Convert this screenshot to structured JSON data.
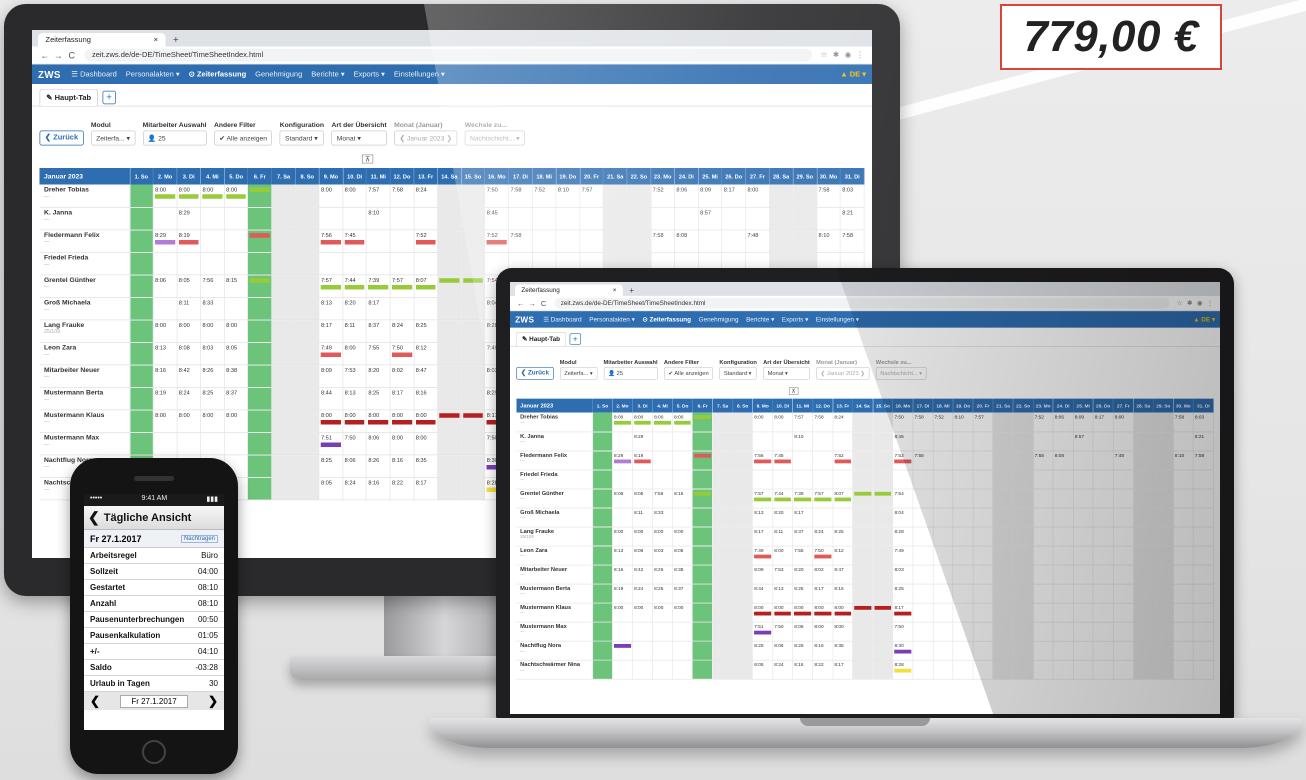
{
  "price": "779,00 €",
  "browser": {
    "tab_title": "Zeiterfassung",
    "tab_close": "×",
    "tab_add": "+",
    "back": "←",
    "forward": "→",
    "reload": "C",
    "url": "zeit.zws.de/de-DE/TimeSheet/TimeSheetIndex.html",
    "icons": [
      "star-icon",
      "extensions-icon",
      "profile-icon",
      "menu-icon"
    ]
  },
  "app": {
    "logo": "ZWS",
    "nav": [
      "☰ Dashboard",
      "Personalakten ▾",
      "⊙ Zeiterfassung",
      "Genehmigung",
      "Berichte ▾",
      "Exports ▾",
      "Einstellungen ▾"
    ],
    "nav_right": "▲ DE ▾",
    "view_tab": "✎ Haupt-Tab",
    "add_tab": "+",
    "filters": {
      "back_button": "❮ Zurück",
      "modul_label": "Modul",
      "modul_value": "Zeiterfa...   ▾",
      "mitarbeiter_label": "Mitarbeiter Auswahl",
      "mitarbeiter_value": "👤 25",
      "andere_filter_label": "Andere Filter",
      "andere_filter_value": "✔ Alle anzeigen",
      "konfiguration_label": "Konfiguration",
      "konfiguration_value": "Standard   ▾",
      "uebersicht_label": "Art der Übersicht",
      "uebersicht_value": "Monat                ▾",
      "monat_label": "Monat (Januar)",
      "monat_value": "❮   Januar 2023   ❯",
      "wechsle_label": "Wechsle zu...",
      "wechsle_value": "Nachtschicht...   ▾",
      "collapse": "⊼"
    },
    "grid": {
      "month_header": "Januar 2023",
      "days": [
        "1. So",
        "2. Mo",
        "3. Di",
        "4. Mi",
        "5. Do",
        "6. Fr",
        "7. Sa",
        "8. So",
        "9. Mo",
        "10. Di",
        "11. Mi",
        "12. Do",
        "13. Fr",
        "14. Sa",
        "15. So",
        "16. Mo",
        "17. Di",
        "18. Mi",
        "19. Do",
        "20. Fr",
        "21. Sa",
        "22. So",
        "23. Mo",
        "24. Di",
        "25. Mi",
        "26. Do",
        "27. Fr",
        "28. Sa",
        "29. So",
        "30. Mo",
        "31. Di"
      ],
      "rows": [
        {
          "name": "Dreher Tobias",
          "sub": "—",
          "vals": [
            "",
            "8:00",
            "8:00",
            "8:00",
            "8:00",
            "",
            "",
            "",
            "8:00",
            "8:00",
            "7:57",
            "7:58",
            "8:24",
            "",
            "",
            "7:50",
            "7:58",
            "7:52",
            "8:10",
            "7:57",
            "",
            "",
            "7:52",
            "8:06",
            "8:09",
            "8:17",
            "8:00",
            "",
            "",
            "7:58",
            "8:03"
          ]
        },
        {
          "name": "K. Janna",
          "sub": "—",
          "vals": [
            "",
            "",
            "8:29",
            "",
            "",
            "",
            "",
            "",
            "",
            "",
            "8:10",
            "",
            "",
            "",
            "",
            "8:45",
            "",
            "",
            "",
            "",
            "",
            "",
            "",
            "",
            "8:57",
            "",
            "",
            "",
            "",
            "",
            "8:21"
          ]
        },
        {
          "name": "Fledermann Felix",
          "sub": "—",
          "vals": [
            "",
            "8:29",
            "8:19",
            "",
            "",
            "",
            "",
            "",
            "7:56",
            "7:45",
            "",
            "",
            "7:52",
            "",
            "",
            "7:52",
            "7:58",
            "",
            "",
            "",
            "",
            "",
            "7:58",
            "8:08",
            "",
            "",
            "7:48",
            "",
            "",
            "8:10",
            "7:58"
          ]
        },
        {
          "name": "Friedel Frieda",
          "sub": "—",
          "vals": []
        },
        {
          "name": "Grentel Günther",
          "sub": "—",
          "vals": [
            "",
            "8:06",
            "8:05",
            "7:56",
            "8:15",
            "",
            "",
            "",
            "7:57",
            "7:44",
            "7:39",
            "7:57",
            "8:07",
            "",
            "",
            "7:54",
            "",
            "",
            "",
            "",
            "",
            "",
            "",
            "",
            "",
            "",
            "",
            "",
            "",
            "",
            ""
          ]
        },
        {
          "name": "Groß Michaela",
          "sub": "—",
          "vals": [
            "",
            "",
            "8:11",
            "8:33",
            "",
            "",
            "",
            "",
            "8:13",
            "8:20",
            "8:17",
            "",
            "",
            "",
            "",
            "8:04",
            "",
            "",
            "",
            "",
            "",
            "",
            "",
            "",
            "",
            "",
            "",
            "",
            "",
            "",
            ""
          ]
        },
        {
          "name": "Lang Frauke",
          "sub": "25/109",
          "vals": [
            "",
            "8:00",
            "8:00",
            "8:00",
            "8:00",
            "",
            "",
            "",
            "8:17",
            "8:11",
            "8:37",
            "8:24",
            "8:25",
            "",
            "",
            "8:28",
            "",
            "",
            "",
            "",
            "",
            "",
            "",
            "",
            "",
            "",
            "",
            "",
            "",
            "",
            ""
          ]
        },
        {
          "name": "Leon Zara",
          "sub": "—",
          "vals": [
            "",
            "8:13",
            "8:08",
            "8:03",
            "8:05",
            "",
            "",
            "",
            "7:49",
            "8:00",
            "7:55",
            "7:50",
            "8:12",
            "",
            "",
            "7:49",
            "",
            "",
            "",
            "",
            "",
            "",
            "",
            "",
            "",
            "",
            "",
            "",
            "",
            "",
            ""
          ]
        },
        {
          "name": "Mitarbeiter Neuer",
          "sub": "—",
          "vals": [
            "",
            "8:16",
            "8:42",
            "8:26",
            "8:38",
            "",
            "",
            "",
            "8:09",
            "7:53",
            "8:20",
            "8:02",
            "8:47",
            "",
            "",
            "8:03",
            "",
            "",
            "",
            "",
            "",
            "",
            "",
            "",
            "",
            "",
            "",
            "",
            "",
            "",
            ""
          ]
        },
        {
          "name": "Mustermann Berta",
          "sub": "—",
          "vals": [
            "",
            "8:19",
            "8:24",
            "8:25",
            "8:37",
            "",
            "",
            "",
            "8:44",
            "8:13",
            "8:25",
            "8:17",
            "8:16",
            "",
            "",
            "8:25",
            "",
            "",
            "",
            "",
            "",
            "",
            "",
            "",
            "",
            "",
            "",
            "",
            "",
            "",
            ""
          ]
        },
        {
          "name": "Mustermann Klaus",
          "sub": "—",
          "vals": [
            "",
            "8:00",
            "8:00",
            "8:00",
            "8:00",
            "",
            "",
            "",
            "8:00",
            "8:00",
            "8:00",
            "8:00",
            "8:00",
            "",
            "",
            "8:17",
            "",
            "",
            "",
            "",
            "",
            "",
            "",
            "",
            "",
            "",
            "",
            "",
            "",
            "",
            ""
          ]
        },
        {
          "name": "Mustermann Max",
          "sub": "—",
          "vals": [
            "",
            "",
            "",
            "",
            "",
            "",
            "",
            "",
            "7:51",
            "7:50",
            "8:06",
            "8:00",
            "8:00",
            "",
            "",
            "7:50",
            "",
            "",
            "",
            "",
            "",
            "",
            "",
            "",
            "",
            "",
            "",
            "",
            "",
            "",
            ""
          ]
        },
        {
          "name": "Nachtflug Nora",
          "sub": "—",
          "vals": [
            "",
            "",
            "",
            "",
            "",
            "",
            "",
            "",
            "8:25",
            "8:06",
            "8:26",
            "8:16",
            "8:35",
            "",
            "",
            "8:30",
            "",
            "",
            "",
            "",
            "",
            "",
            "",
            "",
            "",
            "",
            "",
            "",
            "",
            "",
            ""
          ]
        },
        {
          "name": "Nachtschwärmer Nina",
          "sub": "—",
          "vals": [
            "",
            "",
            "",
            "",
            "",
            "",
            "",
            "",
            "8:05",
            "8:24",
            "8:16",
            "8:22",
            "8:17",
            "",
            "",
            "8:28",
            "",
            "",
            "",
            "",
            "",
            "",
            "",
            "",
            "",
            "",
            "",
            "",
            "",
            "",
            ""
          ]
        }
      ]
    }
  },
  "phone": {
    "status_left": "•••••",
    "status_center": "9:41 AM",
    "status_right": "▮▮▮",
    "title": "Tägliche Ansicht",
    "back": "❮",
    "date": "Fr 27.1.2017",
    "date_link": "Nachtragen",
    "rows": [
      {
        "label": "Arbeitsregel",
        "value": "Büro"
      },
      {
        "label": "Sollzeit",
        "value": "04:00"
      },
      {
        "label": "Gestartet",
        "value": "08:10"
      },
      {
        "label": "Anzahl",
        "value": "08:10"
      },
      {
        "label": "Pausenunterbrechungen",
        "value": "00:50"
      },
      {
        "label": "Pausenkalkulation",
        "value": "01:05"
      },
      {
        "label": "+/-",
        "value": "04:10"
      },
      {
        "label": "Saldo",
        "value": "-03:28"
      },
      {
        "label": "Urlaub in Tagen",
        "value": "30"
      }
    ],
    "footer_prev": "❮",
    "footer_date": "Fr 27.1.2017",
    "footer_next": "❯"
  }
}
